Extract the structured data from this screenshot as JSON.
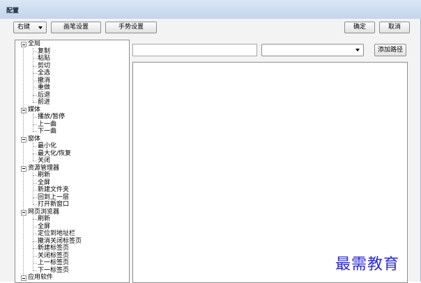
{
  "window": {
    "title": "配置"
  },
  "toolbar": {
    "mode_select": "右键",
    "pen_settings": "画笔设置",
    "gesture_settings": "手势设置",
    "ok": "确定",
    "cancel": "取消"
  },
  "path": {
    "input_value": "",
    "combo_value": "",
    "add_path": "添加路径"
  },
  "tree": {
    "groups": [
      {
        "label": "全局",
        "items": [
          "复制",
          "粘贴",
          "剪切",
          "全选",
          "撤消",
          "重做",
          "后退",
          "前进"
        ]
      },
      {
        "label": "媒体",
        "items": [
          "播放/暂停",
          "上一曲",
          "下一曲"
        ]
      },
      {
        "label": "窗体",
        "items": [
          "最小化",
          "最大化/恢复",
          "关闭"
        ]
      },
      {
        "label": "资源管理器",
        "items": [
          "刷新",
          "全屏",
          "新建文件夹",
          "回到上一层",
          "打开新窗口"
        ]
      },
      {
        "label": "网页浏览器",
        "items": [
          "刷新",
          "全屏",
          "定位到地址栏",
          "撤消关闭标签页",
          "新建标签页",
          "关闭标签页",
          "上一标签页",
          "下一标签页"
        ]
      },
      {
        "label": "应用软件",
        "items": []
      }
    ]
  },
  "watermark": "最需教育"
}
